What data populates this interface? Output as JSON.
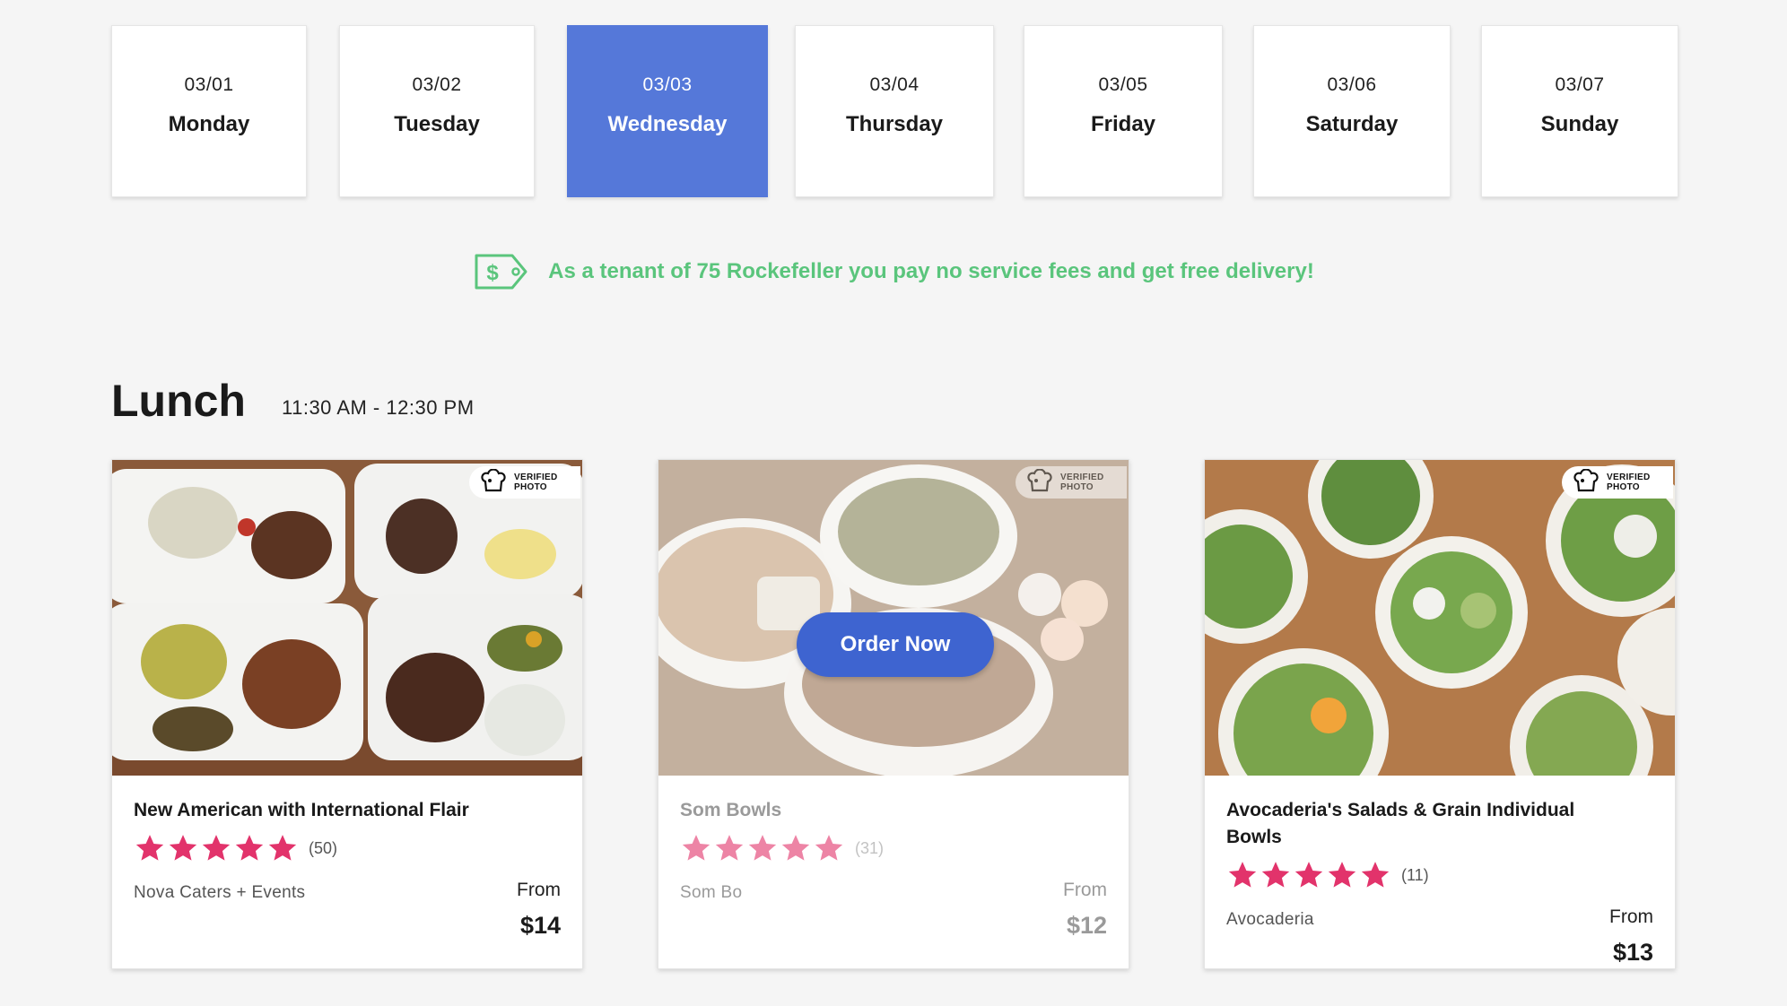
{
  "days": [
    {
      "date": "03/01",
      "name": "Monday",
      "active": false
    },
    {
      "date": "03/02",
      "name": "Tuesday",
      "active": false
    },
    {
      "date": "03/03",
      "name": "Wednesday",
      "active": true
    },
    {
      "date": "03/04",
      "name": "Thursday",
      "active": false
    },
    {
      "date": "03/05",
      "name": "Friday",
      "active": false
    },
    {
      "date": "03/06",
      "name": "Saturday",
      "active": false
    },
    {
      "date": "03/07",
      "name": "Sunday",
      "active": false
    }
  ],
  "promo": {
    "text": "As a tenant of 75 Rockefeller you pay no service fees and get free delivery!",
    "icon": "price-tag-dollar-icon",
    "color": "#5ac57c"
  },
  "meal": {
    "title": "Lunch",
    "time": "11:30 AM - 12:30 PM"
  },
  "verified_label": "VERIFIED PHOTO",
  "cards": [
    {
      "name": "New American with International Flair",
      "rating_count": "(50)",
      "stars": 5,
      "vendor": "Nova Caters + Events",
      "from_label": "From",
      "price": "$14"
    },
    {
      "name": "Som Bowls",
      "rating_count": "(31)",
      "stars": 5,
      "vendor": "Som Bo",
      "from_label": "From",
      "price": "$12",
      "order_button": "Order Now"
    },
    {
      "name": "Avocaderia's Salads & Grain Individual Bowls",
      "rating_count": "(11)",
      "stars": 5,
      "vendor": "Avocaderia",
      "from_label": "From",
      "price": "$13"
    }
  ],
  "colors": {
    "accent": "#5578d9",
    "button": "#3e64d0",
    "star": "#e2336b",
    "promo_green": "#5ac57c"
  }
}
